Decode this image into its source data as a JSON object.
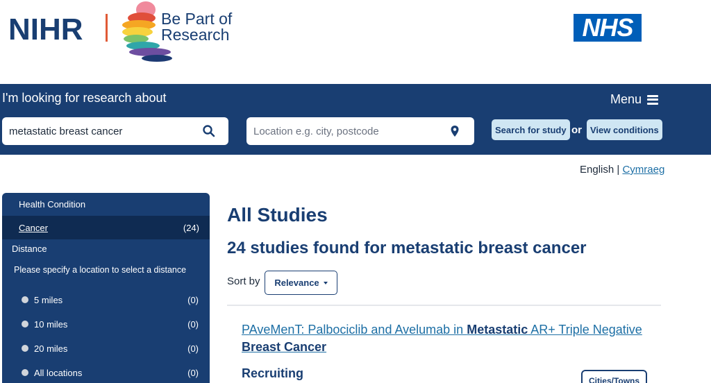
{
  "header": {
    "nihr": "NIHR",
    "bpor": "Be Part of Research",
    "nhs": "NHS"
  },
  "search": {
    "label": "I'm looking for research about",
    "menu": "Menu",
    "condition_value": "metastatic breast cancer",
    "location_placeholder": "Location e.g. city, postcode",
    "search_button": "Search for study",
    "or": "or",
    "view_button": "View conditions"
  },
  "language": {
    "english": "English",
    "sep": " | ",
    "welsh": "Cymraeg"
  },
  "sidebar": {
    "health_condition": "Health Condition",
    "cancer": "Cancer",
    "cancer_count": "(24)",
    "distance": "Distance",
    "hint": "Please specify a location to select a distance",
    "options": [
      {
        "label": "5 miles",
        "count": "(0)"
      },
      {
        "label": "10 miles",
        "count": "(0)"
      },
      {
        "label": "20 miles",
        "count": "(0)"
      },
      {
        "label": "All locations",
        "count": "(0)"
      }
    ]
  },
  "main": {
    "title": "All Studies",
    "found": "24 studies found for metastatic breast cancer",
    "sort_label": "Sort by",
    "sort_value": "Relevance",
    "study": {
      "part1": "PAveMenT: Palbociclib and Avelumab in ",
      "bold1": "Metastatic",
      "part2": " AR+ Triple Negative ",
      "bold2": "Breast Cancer",
      "status": "Recruiting",
      "tag": "Cities/Towns"
    }
  },
  "colors": {
    "navy": "#193e72",
    "nhs_blue": "#005eb8",
    "light_button": "#cfe6f3",
    "link": "#1d6fa5"
  }
}
